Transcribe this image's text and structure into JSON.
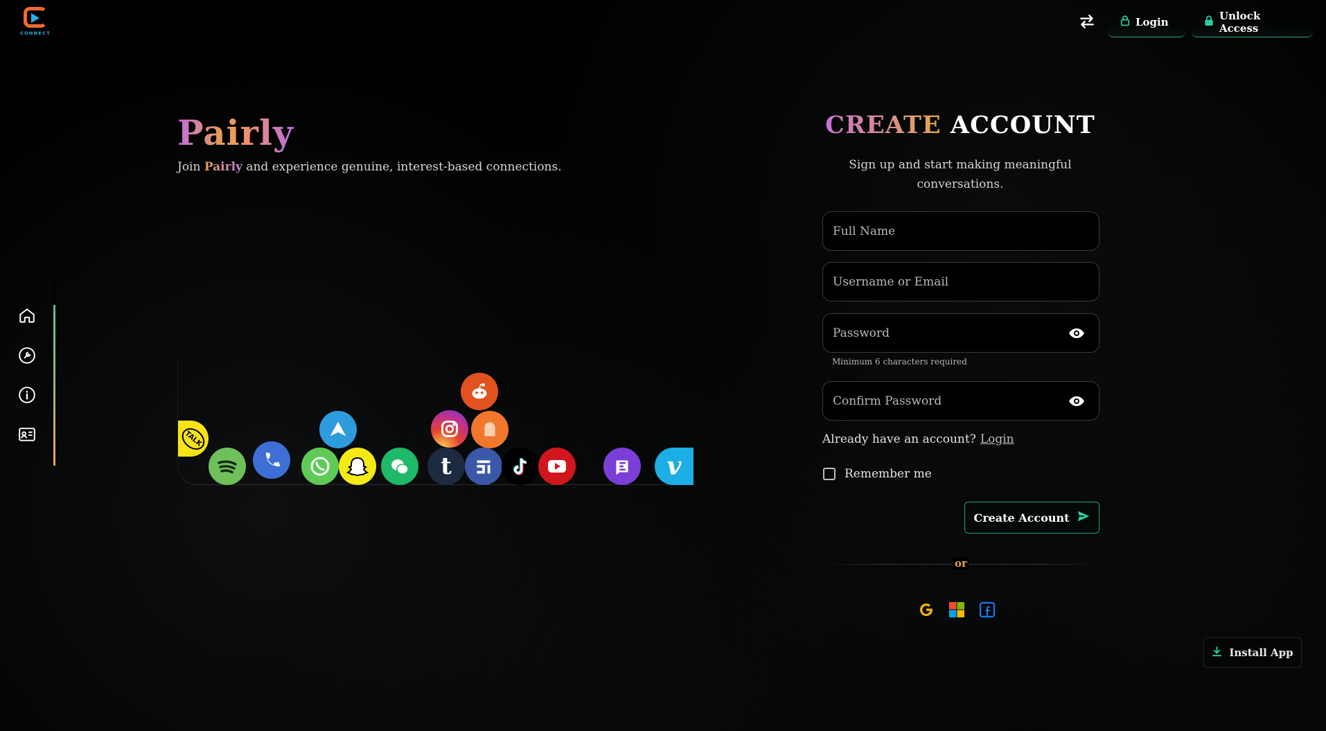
{
  "header": {
    "logo_text": "CONNECT",
    "login_label": "Login",
    "unlock_label": "Unlock Access"
  },
  "sidebar": {
    "items": [
      {
        "icon": "home-icon"
      },
      {
        "icon": "tools-icon"
      },
      {
        "icon": "info-icon"
      },
      {
        "icon": "contact-card-icon"
      }
    ]
  },
  "hero": {
    "title": "Pairly",
    "subtitle_prefix": "Join",
    "subtitle_brand": "Pairly",
    "subtitle_suffix": "and experience genuine, interest-based connections."
  },
  "bubbles": [
    {
      "name": "kakaotalk-bubble",
      "label": "TALK",
      "color": "#f7e316"
    },
    {
      "name": "spotify-bubble",
      "label": "",
      "color": "#6fc05a"
    },
    {
      "name": "phone-bubble",
      "label": "",
      "color": "#3d6fd6"
    },
    {
      "name": "telegram-bubble",
      "label": "",
      "color": "#2e9bdc"
    },
    {
      "name": "whatsapp-bubble",
      "label": "",
      "color": "#5fcb57"
    },
    {
      "name": "snapchat-bubble",
      "label": "",
      "color": "#f5ea18"
    },
    {
      "name": "wechat-bubble",
      "label": "",
      "color": "#1fb96a"
    },
    {
      "name": "instagram-bubble",
      "label": "",
      "color": "#d43a8a"
    },
    {
      "name": "reddit-bubble",
      "label": "",
      "color": "#e2521f"
    },
    {
      "name": "soundcloud-bubble",
      "label": "",
      "color": "#f1772c"
    },
    {
      "name": "tumblr-bubble",
      "label": "t",
      "color": "#1e2a40"
    },
    {
      "name": "forum-bubble",
      "label": "",
      "color": "#3a58a8"
    },
    {
      "name": "tiktok-bubble",
      "label": "",
      "color": "#000000"
    },
    {
      "name": "youtube-bubble",
      "label": "",
      "color": "#d2161e"
    },
    {
      "name": "element-bubble",
      "label": "",
      "color": "#7b3fd8"
    },
    {
      "name": "vimeo-bubble",
      "label": "v",
      "color": "#1daee6"
    }
  ],
  "form": {
    "title_accent": "CREATE",
    "title_rest": "ACCOUNT",
    "subtitle": "Sign up and start making meaningful conversations.",
    "full_name_placeholder": "Full Name",
    "username_placeholder": "Username or Email",
    "password_placeholder": "Password",
    "password_hint": "Minimum 6 characters required",
    "confirm_placeholder": "Confirm Password",
    "have_account_text": "Already have an account?",
    "login_link": "Login",
    "remember_label": "Remember me",
    "create_label": "Create Account",
    "or_text": "or"
  },
  "social_login": [
    "google-icon",
    "microsoft-icon",
    "facebook-icon"
  ],
  "install": {
    "label": "Install App"
  },
  "colors": {
    "accent_teal": "#2c9d86",
    "accent_orange": "#e8a64a",
    "accent_purple": "#c870d8"
  }
}
